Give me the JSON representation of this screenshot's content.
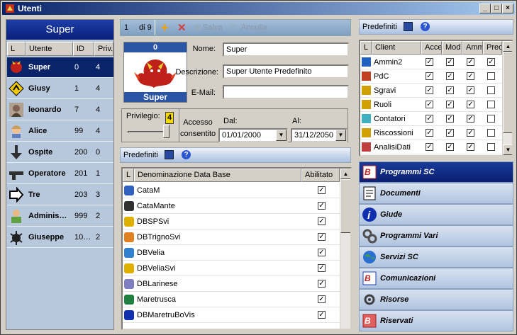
{
  "window": {
    "title": "Utenti"
  },
  "users_panel": {
    "header": "Super",
    "columns": {
      "l": "L",
      "user": "Utente",
      "id": "ID",
      "priv": "Priv."
    },
    "users": [
      {
        "name": "Super",
        "id": "0",
        "priv": "4",
        "icon": "red-dragon-icon",
        "selected": true
      },
      {
        "name": "Giusy",
        "id": "1",
        "priv": "4",
        "icon": "warning-sign-icon"
      },
      {
        "name": "leonardo",
        "id": "7",
        "priv": "4",
        "icon": "leonardo-portrait-icon"
      },
      {
        "name": "Alice",
        "id": "99",
        "priv": "4",
        "icon": "alice-avatar-icon"
      },
      {
        "name": "Ospite",
        "id": "200",
        "priv": "0",
        "icon": "arrow-down-icon"
      },
      {
        "name": "Operatore",
        "id": "201",
        "priv": "1",
        "icon": "gun-icon"
      },
      {
        "name": "Tre",
        "id": "203",
        "priv": "3",
        "icon": "arrow-right-icon"
      },
      {
        "name": "Adminis…",
        "id": "999",
        "priv": "2",
        "icon": "admin-person-icon"
      },
      {
        "name": "Giuseppe",
        "id": "10…",
        "priv": "2",
        "icon": "bug-icon"
      }
    ]
  },
  "nav": {
    "position": "1",
    "of": "di 9",
    "save": "Salva",
    "cancel": "Annulla"
  },
  "record": {
    "avatar_count": "0",
    "avatar_name": "Super",
    "name_label": "Nome:",
    "name_value": "Super",
    "desc_label": "Descrizione:",
    "desc_value": "Super Utente Predefinito",
    "email_label": "E-Mail:",
    "email_value": "",
    "priv_label": "Privilegio:",
    "priv_value": "4",
    "priv_level": 1.0,
    "access_label": "Accesso consentito",
    "from_label": "Dal:",
    "from_value": "01/01/2000",
    "to_label": "Al:",
    "to_value": "31/12/2050"
  },
  "db_section": {
    "title": "Predefiniti",
    "col_l": "L",
    "col_name": "Denominazione Data Base",
    "col_enabled": "Abilitato",
    "rows": [
      {
        "name": "CataM",
        "enabled": true
      },
      {
        "name": "CataMante",
        "enabled": true
      },
      {
        "name": "DBSPSvi",
        "enabled": true
      },
      {
        "name": "DBTrignoSvi",
        "enabled": true
      },
      {
        "name": "DBVelia",
        "enabled": true
      },
      {
        "name": "DBVeliaSvi",
        "enabled": true
      },
      {
        "name": "DBLarinese",
        "enabled": true
      },
      {
        "name": "Maretrusca",
        "enabled": true
      },
      {
        "name": "DBMaretruBoVis",
        "enabled": true
      }
    ]
  },
  "client_section": {
    "title": "Predefiniti",
    "cols": {
      "l": "L",
      "client": "Client",
      "acc": "Acce",
      "mod": "Mod",
      "amm": "Amm",
      "pred": "Prec"
    },
    "rows": [
      {
        "name": "Ammin2",
        "acc": true,
        "mod": true,
        "amm": true,
        "pred": true
      },
      {
        "name": "PdC",
        "acc": true,
        "mod": true,
        "amm": true,
        "pred": false
      },
      {
        "name": "Sgravi",
        "acc": true,
        "mod": true,
        "amm": true,
        "pred": false
      },
      {
        "name": "Ruoli",
        "acc": true,
        "mod": true,
        "amm": true,
        "pred": false
      },
      {
        "name": "Contatori",
        "acc": true,
        "mod": true,
        "amm": true,
        "pred": false
      },
      {
        "name": "Riscossioni",
        "acc": true,
        "mod": true,
        "amm": true,
        "pred": false
      },
      {
        "name": "AnalisiDati",
        "acc": true,
        "mod": true,
        "amm": true,
        "pred": false
      }
    ]
  },
  "menu": [
    {
      "label": "Programmi SC",
      "selected": true,
      "icon": "programs-sc-icon"
    },
    {
      "label": "Documenti",
      "icon": "documents-icon"
    },
    {
      "label": "Giude",
      "icon": "info-icon"
    },
    {
      "label": "Programmi Vari",
      "icon": "gears-icon"
    },
    {
      "label": "Servizi SC",
      "icon": "globe-services-icon"
    },
    {
      "label": "Comunicazioni",
      "icon": "communications-icon"
    },
    {
      "label": "Risorse",
      "icon": "resources-gear-icon"
    },
    {
      "label": "Riservati",
      "icon": "reserved-icon"
    }
  ],
  "colors": {
    "selection": "#0a246a",
    "panel": "#b8c8dc",
    "face": "#d4d0c8"
  }
}
